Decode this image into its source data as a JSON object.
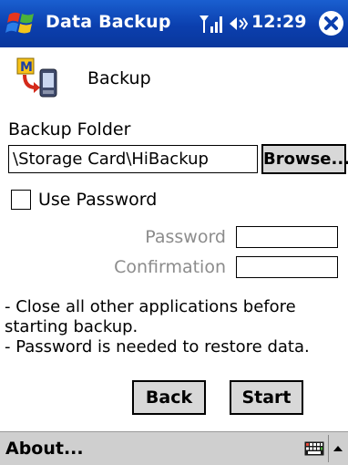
{
  "window": {
    "title": "Data Backup",
    "clock": "12:29"
  },
  "header": {
    "section_title": "Backup"
  },
  "folder": {
    "label": "Backup Folder",
    "value": "\\Storage Card\\HiBackup",
    "browse_label": "Browse..."
  },
  "password": {
    "use_label": "Use Password",
    "checked": false,
    "password_label": "Password",
    "confirmation_label": "Confirmation"
  },
  "notes": {
    "line1": "- Close all other applications before starting backup.",
    "line2": "- Password is needed to restore data."
  },
  "buttons": {
    "back_label": "Back",
    "start_label": "Start"
  },
  "menubar": {
    "about_label": "About..."
  },
  "icons": {
    "start": "windows-flag-icon",
    "signal": "signal-strength-icon",
    "volume": "speaker-volume-icon",
    "close": "close-icon",
    "app": "backup-app-icon",
    "keyboard": "keyboard-icon",
    "sip": "chevron-up-icon"
  },
  "colors": {
    "titlebar": "#0b3fae",
    "menubar": "#cfcfcf",
    "disabled_text": "#8c8c8c"
  }
}
